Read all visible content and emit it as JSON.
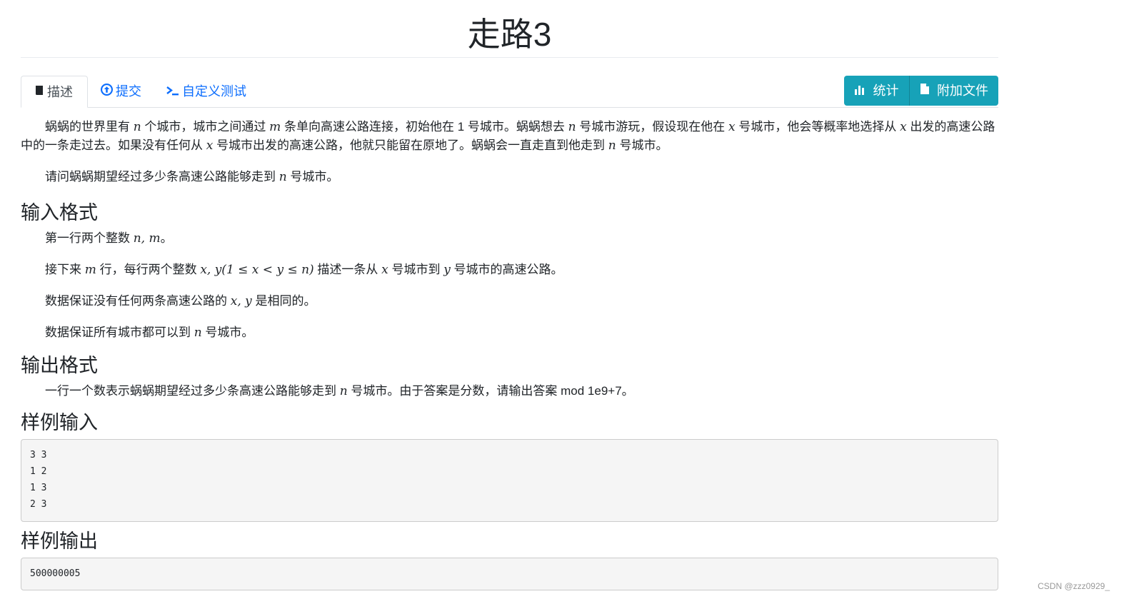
{
  "title": "走路3",
  "tabs": [
    {
      "label": "描述",
      "icon": "book-icon"
    },
    {
      "label": "提交",
      "icon": "upload-circle-icon"
    },
    {
      "label": "自定义测试",
      "icon": "terminal-icon"
    }
  ],
  "buttons": {
    "stats": {
      "label": "统计",
      "icon": "bar-chart-icon"
    },
    "files": {
      "label": "附加文件",
      "icon": "file-icon"
    }
  },
  "description": {
    "p1_a": "蜗蜗的世界里有 ",
    "p1_n": "n",
    "p1_b": " 个城市，城市之间通过 ",
    "p1_m": "m",
    "p1_c": " 条单向高速公路连接，初始他在 1 号城市。蜗蜗想去 ",
    "p1_n2": "n",
    "p1_d": " 号城市游玩，假设现在他在 ",
    "p1_x": "x",
    "p1_e": " 号城市，他会等概率地选择从 ",
    "p1_x2": "x",
    "p1_f": " 出发的高速公路中的一条走过去。如果没有任何从 ",
    "p1_x3": "x",
    "p1_g": " 号城市出发的高速公路，他就只能留在原地了。蜗蜗会一直走直到他走到 ",
    "p1_n3": "n",
    "p1_h": " 号城市。",
    "p2_a": "请问蜗蜗期望经过多少条高速公路能够走到 ",
    "p2_n": "n",
    "p2_b": " 号城市。"
  },
  "input_section": {
    "heading": "输入格式",
    "l1_a": "第一行两个整数 ",
    "l1_m": "n, m",
    "l1_b": "。",
    "l2_a": "接下来 ",
    "l2_m": "m",
    "l2_b": " 行，每行两个整数 ",
    "l2_m2": "x, y(1 ≤ x < y ≤ n)",
    "l2_c": " 描述一条从 ",
    "l2_m3": "x",
    "l2_d": " 号城市到 ",
    "l2_m4": "y",
    "l2_e": " 号城市的高速公路。",
    "l3_a": "数据保证没有任何两条高速公路的 ",
    "l3_m": "x, y",
    "l3_b": " 是相同的。",
    "l4_a": "数据保证所有城市都可以到 ",
    "l4_m": "n",
    "l4_b": " 号城市。"
  },
  "output_section": {
    "heading": "输出格式",
    "l1_a": "一行一个数表示蜗蜗期望经过多少条高速公路能够走到 ",
    "l1_m": "n",
    "l1_b": " 号城市。由于答案是分数，请输出答案 mod 1e9+7。"
  },
  "sample_input": {
    "heading": "样例输入",
    "text": "3 3\n1 2\n1 3\n2 3"
  },
  "sample_output": {
    "heading": "样例输出",
    "text": "500000005"
  },
  "watermark": "CSDN @zzz0929_"
}
